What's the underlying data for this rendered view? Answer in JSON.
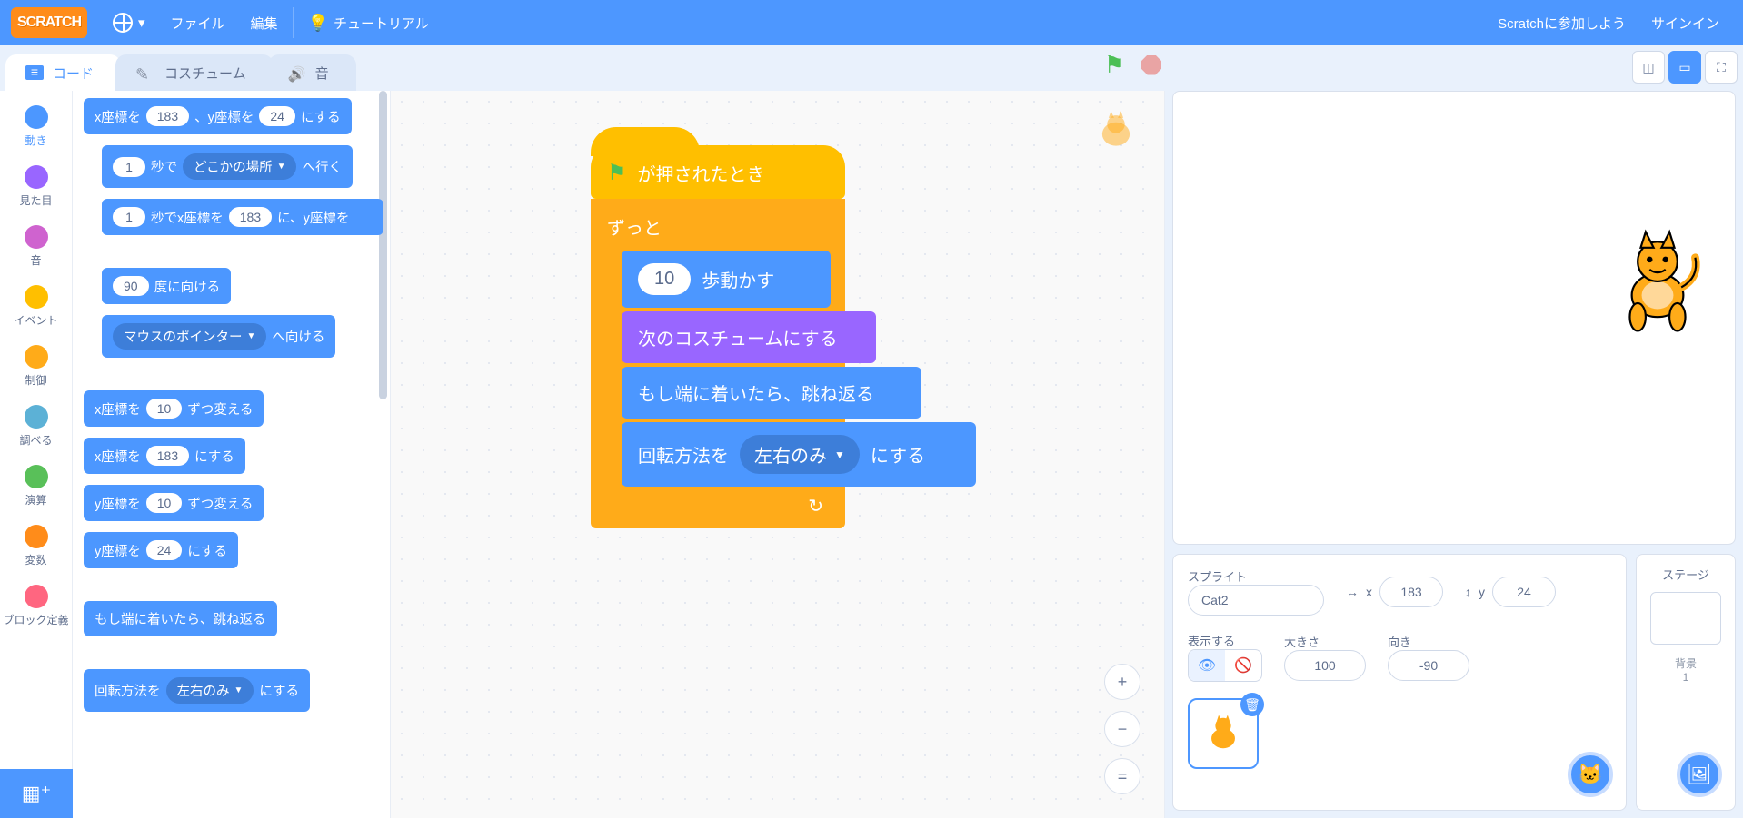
{
  "menubar": {
    "logo": "SCRATCH",
    "file": "ファイル",
    "edit": "編集",
    "tutorials": "チュートリアル",
    "join": "Scratchに参加しよう",
    "signin": "サインイン"
  },
  "tabs": {
    "code": "コード",
    "costumes": "コスチューム",
    "sounds": "音"
  },
  "categories": [
    {
      "name": "動き",
      "color": "#4c97ff",
      "sel": true
    },
    {
      "name": "見た目",
      "color": "#9966ff"
    },
    {
      "name": "音",
      "color": "#cf63cf"
    },
    {
      "name": "イベント",
      "color": "#ffbf00"
    },
    {
      "name": "制御",
      "color": "#ffab19"
    },
    {
      "name": "調べる",
      "color": "#5cb1d6"
    },
    {
      "name": "演算",
      "color": "#59c059"
    },
    {
      "name": "変数",
      "color": "#ff8c1a"
    },
    {
      "name": "ブロック定義",
      "color": "#ff6680"
    }
  ],
  "palette": {
    "goto_xy": {
      "pre": "x座標を",
      "x": "183",
      "mid": "、y座標を",
      "y": "24",
      "post": "にする"
    },
    "glide_rand": {
      "sec": "1",
      "mid": "秒で",
      "target": "どこかの場所",
      "post": "へ行く"
    },
    "glide_xy": {
      "sec": "1",
      "mid": "秒でx座標を",
      "x": "183",
      "mid2": "に、y座標を"
    },
    "point_dir": {
      "deg": "90",
      "post": "度に向ける"
    },
    "point_to": {
      "target": "マウスのポインター",
      "post": "へ向ける"
    },
    "change_x": {
      "pre": "x座標を",
      "v": "10",
      "post": "ずつ変える"
    },
    "set_x": {
      "pre": "x座標を",
      "v": "183",
      "post": "にする"
    },
    "change_y": {
      "pre": "y座標を",
      "v": "10",
      "post": "ずつ変える"
    },
    "set_y": {
      "pre": "y座標を",
      "v": "24",
      "post": "にする"
    },
    "bounce": "もし端に着いたら、跳ね返る",
    "rot_style": {
      "pre": "回転方法を",
      "opt": "左右のみ",
      "post": "にする"
    }
  },
  "script": {
    "hat": "が押されたとき",
    "forever": "ずっと",
    "move": {
      "v": "10",
      "post": "歩動かす"
    },
    "next_costume": "次のコスチュームにする",
    "bounce": "もし端に着いたら、跳ね返る",
    "rot": {
      "pre": "回転方法を",
      "opt": "左右のみ",
      "post": "にする"
    }
  },
  "sprite_info": {
    "label_sprite": "スプライト",
    "name": "Cat2",
    "x_label": "x",
    "x": "183",
    "y_label": "y",
    "y": "24",
    "label_show": "表示する",
    "label_size": "大きさ",
    "size": "100",
    "label_dir": "向き",
    "dir": "-90"
  },
  "stage_pane": {
    "label": "ステージ",
    "backdrops_label": "背景",
    "backdrops_count": "1"
  },
  "ws_controls": {
    "zoom_in": "+",
    "zoom_out": "−",
    "reset": "="
  },
  "colors": {
    "motion": "#4c97ff",
    "looks": "#9966ff",
    "sound": "#cf63cf",
    "events": "#ffbf00",
    "control": "#ffab19",
    "sensing": "#5cb1d6",
    "operators": "#59c059",
    "variables": "#ff8c1a",
    "myblocks": "#ff6680",
    "accent": "#4d97ff"
  }
}
